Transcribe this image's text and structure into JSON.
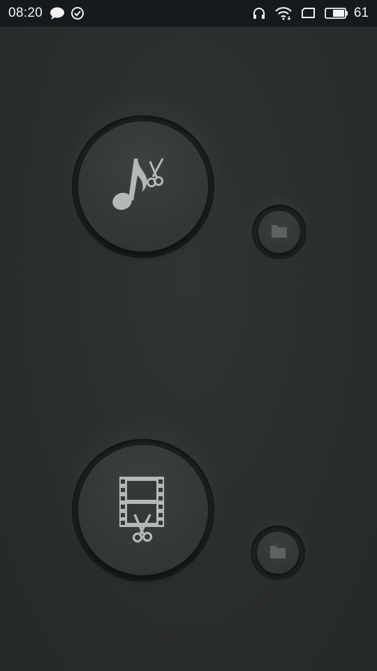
{
  "status_bar": {
    "time": "08:20",
    "battery_level": "61",
    "icons": [
      "chat-bubble-icon",
      "check-circle-icon",
      "headphones-icon",
      "wifi-icon",
      "screen-icon",
      "battery-icon"
    ]
  },
  "tools": [
    {
      "name": "audio-cutter",
      "main_icon": "music-note-scissors-icon",
      "secondary_icon": "folder-icon"
    },
    {
      "name": "video-cutter",
      "main_icon": "film-strip-scissors-icon",
      "secondary_icon": "folder-icon"
    }
  ],
  "colors": {
    "background": "#2a2d2d",
    "status_bar": "#171a1d",
    "icon_fill": "#b4b8b8",
    "folder_fill": "#5e6262"
  }
}
